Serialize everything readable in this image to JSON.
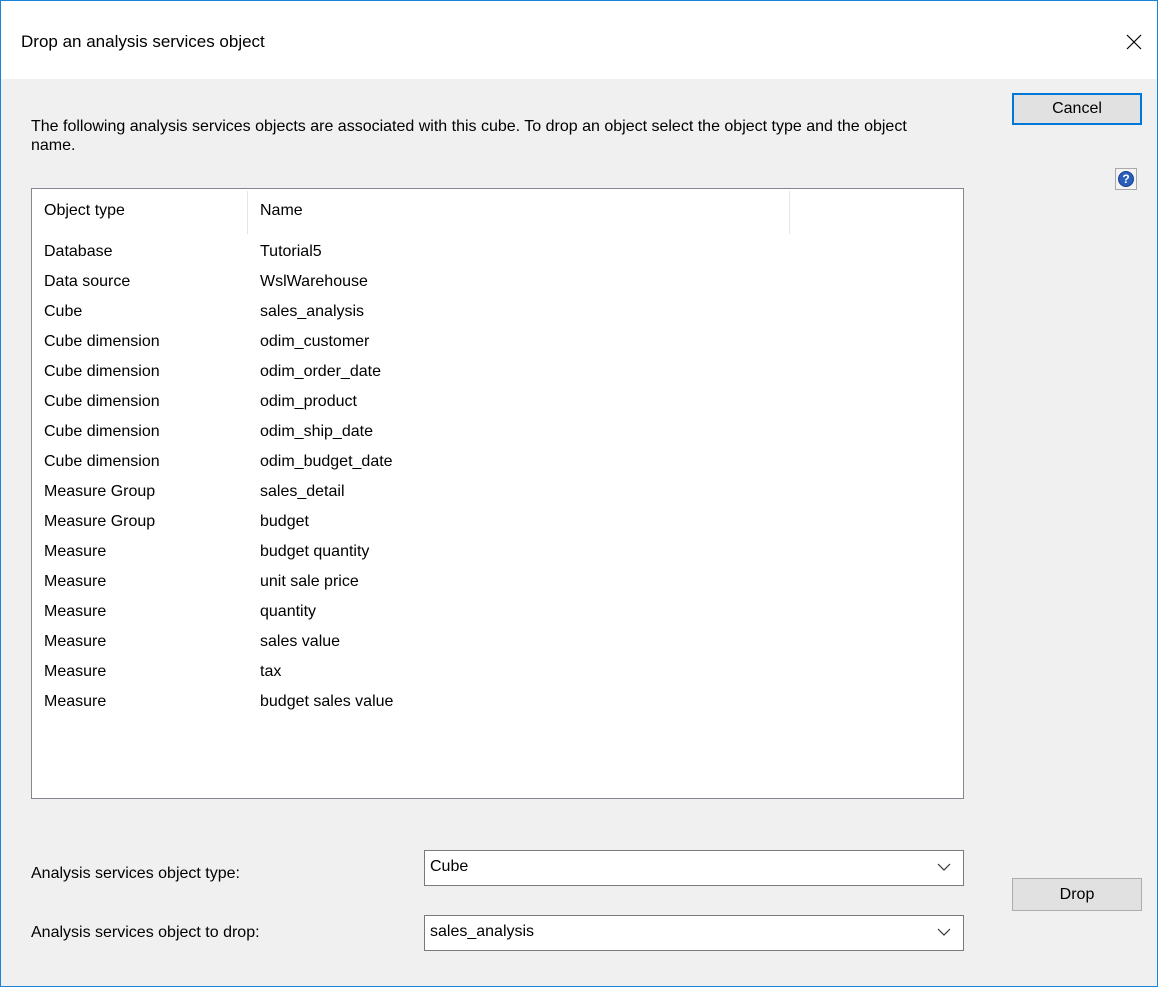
{
  "window": {
    "title": "Drop an analysis services object"
  },
  "description": "The following analysis services objects are associated with this cube. To drop an object select the object type and the object name.",
  "buttons": {
    "cancel": "Cancel",
    "drop": "Drop"
  },
  "list": {
    "columns": [
      "Object type",
      "Name"
    ],
    "rows": [
      {
        "type": "Database",
        "name": "Tutorial5"
      },
      {
        "type": "Data source",
        "name": "WslWarehouse"
      },
      {
        "type": "Cube",
        "name": "sales_analysis"
      },
      {
        "type": "Cube dimension",
        "name": "odim_customer"
      },
      {
        "type": "Cube dimension",
        "name": "odim_order_date"
      },
      {
        "type": "Cube dimension",
        "name": "odim_product"
      },
      {
        "type": "Cube dimension",
        "name": "odim_ship_date"
      },
      {
        "type": "Cube dimension",
        "name": "odim_budget_date"
      },
      {
        "type": "Measure Group",
        "name": "sales_detail"
      },
      {
        "type": "Measure Group",
        "name": "budget"
      },
      {
        "type": "Measure",
        "name": "budget quantity"
      },
      {
        "type": "Measure",
        "name": "unit sale price"
      },
      {
        "type": "Measure",
        "name": "quantity"
      },
      {
        "type": "Measure",
        "name": "sales value"
      },
      {
        "type": "Measure",
        "name": "tax"
      },
      {
        "type": "Measure",
        "name": "budget sales value"
      }
    ]
  },
  "fields": {
    "object_type": {
      "label": "Analysis services object type:",
      "value": "Cube"
    },
    "object_to_drop": {
      "label": "Analysis services object to drop:",
      "value": "sales_analysis"
    }
  },
  "icons": {
    "close": "close-icon",
    "help": "help-icon",
    "dropdown": "chevron-down-icon"
  },
  "colors": {
    "accent": "#0078d7",
    "window_border": "#1883d7",
    "help_icon": "#2a5ebd"
  }
}
